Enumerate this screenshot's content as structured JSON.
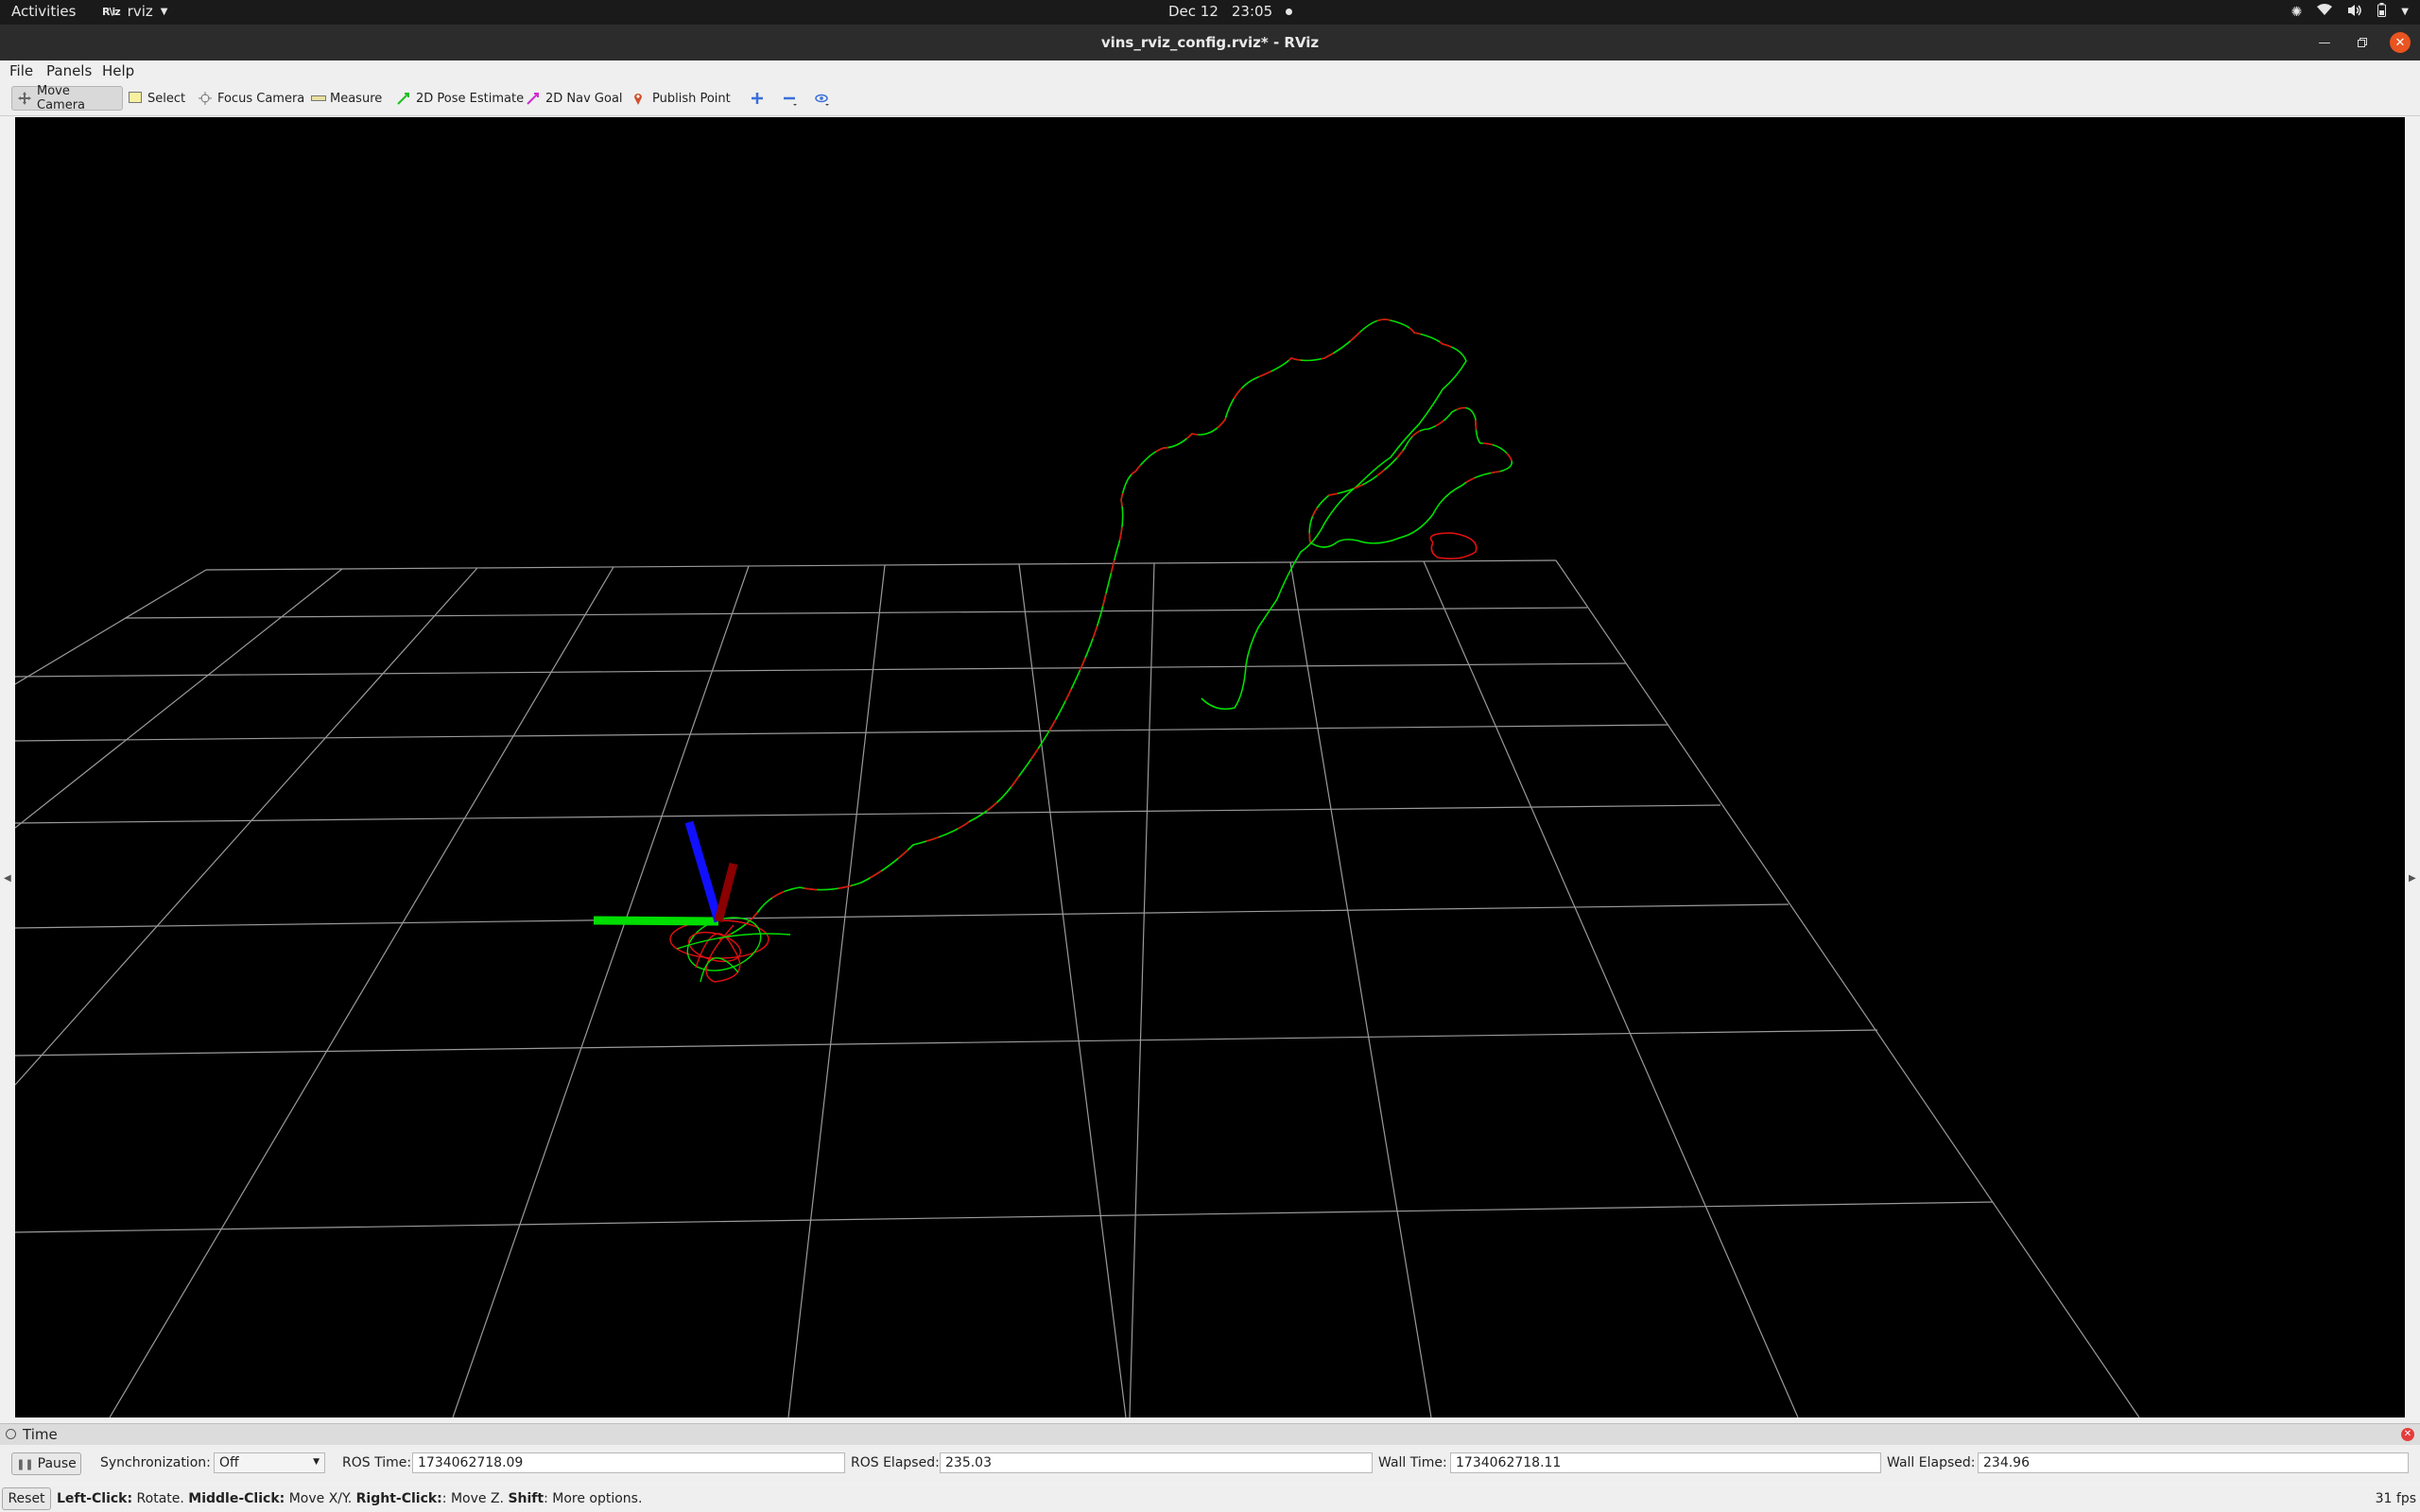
{
  "topbar": {
    "activities": "Activities",
    "app_name": "rviz",
    "app_logo": "R\\iz",
    "date": "Dec 12",
    "time": "23:05",
    "tray_icons": [
      "accessibility-icon",
      "wifi-icon",
      "volume-icon",
      "battery-icon",
      "power-menu-icon"
    ]
  },
  "window": {
    "title": "vins_rviz_config.rviz* - RViz"
  },
  "menubar": {
    "file": "File",
    "panels": "Panels",
    "help": "Help"
  },
  "toolbar": {
    "tools": [
      {
        "label": "Move Camera",
        "icon": "move-camera-icon",
        "active": true
      },
      {
        "label": "Select",
        "icon": "select-icon"
      },
      {
        "label": "Focus Camera",
        "icon": "focus-camera-icon"
      },
      {
        "label": "Measure",
        "icon": "measure-icon"
      },
      {
        "label": "2D Pose Estimate",
        "icon": "pose-estimate-icon"
      },
      {
        "label": "2D Nav Goal",
        "icon": "nav-goal-icon"
      },
      {
        "label": "Publish Point",
        "icon": "publish-point-icon"
      }
    ],
    "extra_icons": [
      "add-tool-icon",
      "remove-tool-icon",
      "view-eye-icon"
    ]
  },
  "viewport": {
    "background": "#000000",
    "grid_color": "#a0a0a0",
    "trajectory_colors": [
      "#00e000",
      "#e01010"
    ],
    "axis_colors": {
      "x": "#8b0000",
      "y": "#00dd00",
      "z": "#1010ff"
    }
  },
  "time_panel": {
    "title": "Time",
    "pause_label": "Pause",
    "sync_label": "Synchronization:",
    "sync_value": "Off",
    "ros_time_label": "ROS Time:",
    "ros_time": "1734062718.09",
    "ros_elapsed_label": "ROS Elapsed:",
    "ros_elapsed": "235.03",
    "wall_time_label": "Wall Time:",
    "wall_time": "1734062718.11",
    "wall_elapsed_label": "Wall Elapsed:",
    "wall_elapsed": "234.96"
  },
  "statusbar": {
    "reset_label": "Reset",
    "hint_left_click": "Left-Click:",
    "hint_left_action": " Rotate. ",
    "hint_middle_click": "Middle-Click:",
    "hint_middle_action": " Move X/Y. ",
    "hint_right_click": "Right-Click:",
    "hint_right_action": ": Move Z. ",
    "hint_shift": "Shift",
    "hint_shift_action": ": More options.",
    "fps": "31 fps"
  }
}
